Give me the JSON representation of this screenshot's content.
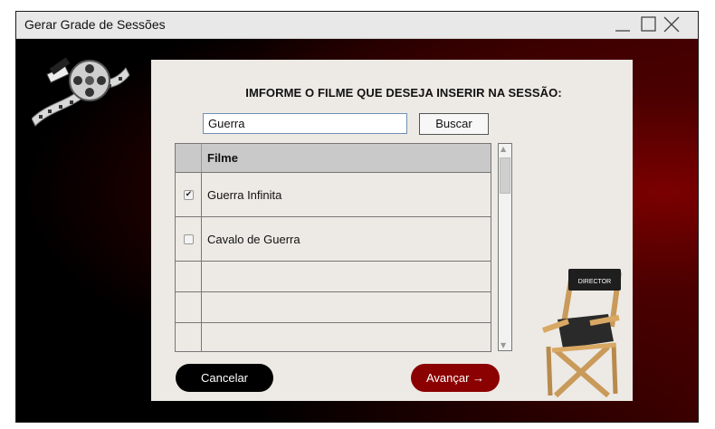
{
  "window": {
    "title": "Gerar Grade de Sessões"
  },
  "controls": {
    "minimize": "minimize-icon",
    "maximize": "maximize-icon",
    "close": "close-icon"
  },
  "panel": {
    "heading": "IMFORME O FILME QUE DESEJA INSERIR NA SESSÃO:",
    "search_value": "Guerra",
    "search_button": "Buscar"
  },
  "table": {
    "header": "Filme",
    "rows": [
      {
        "title": "Guerra Infinita",
        "checked": true
      },
      {
        "title": "Cavalo de Guerra",
        "checked": false
      },
      {
        "title": "",
        "checked": null
      },
      {
        "title": "",
        "checked": null
      },
      {
        "title": "",
        "checked": null
      }
    ]
  },
  "buttons": {
    "cancel": "Cancelar",
    "next": "Avançar →"
  },
  "decor": {
    "film_reel": "film-reel-icon",
    "director_chair": "director-chair-icon",
    "chair_label": "DIRECTOR"
  },
  "colors": {
    "accent": "#8b0000",
    "dark": "#000000",
    "panel": "#edeae5"
  }
}
